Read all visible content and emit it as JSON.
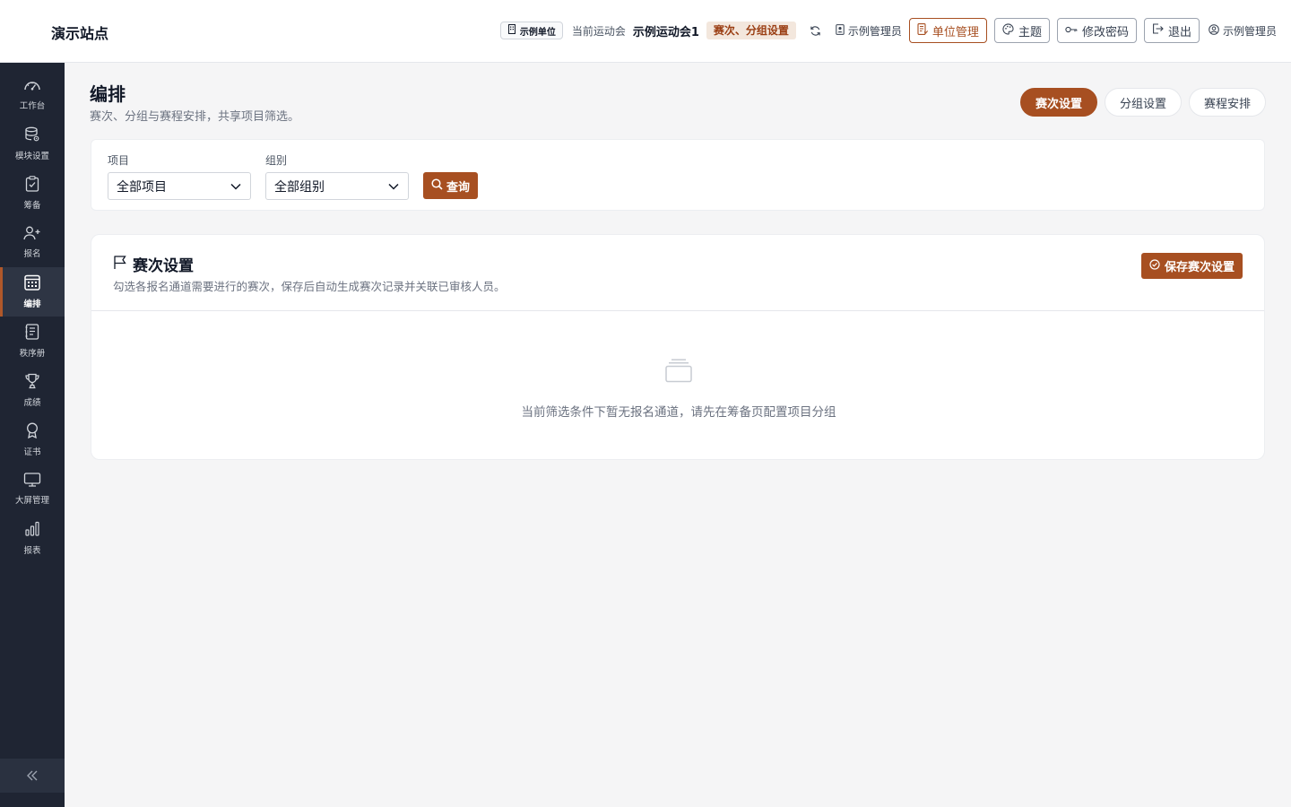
{
  "header": {
    "site_name": "演示站点",
    "unit_chip": "示例单位",
    "current_meet_label": "当前运动会",
    "current_meet": "示例运动会1",
    "setting_tag": "赛次、分组设置",
    "admin_role": "示例管理员",
    "buttons": {
      "unit_manage": "单位管理",
      "theme": "主题",
      "change_password": "修改密码",
      "logout": "退出"
    },
    "user_name": "示例管理员"
  },
  "sidebar": {
    "items": [
      {
        "label": "工作台",
        "icon": "dashboard-icon"
      },
      {
        "label": "模块设置",
        "icon": "database-icon"
      },
      {
        "label": "筹备",
        "icon": "clipboard-icon"
      },
      {
        "label": "报名",
        "icon": "user-add-icon"
      },
      {
        "label": "编排",
        "icon": "calendar-grid-icon",
        "active": true
      },
      {
        "label": "秩序册",
        "icon": "booklet-icon"
      },
      {
        "label": "成绩",
        "icon": "trophy-icon"
      },
      {
        "label": "证书",
        "icon": "award-icon"
      },
      {
        "label": "大屏管理",
        "icon": "monitor-icon"
      },
      {
        "label": "报表",
        "icon": "bar-chart-icon"
      }
    ],
    "collapse_icon": "double-chevron-left-icon"
  },
  "page": {
    "title": "编排",
    "subtitle": "赛次、分组与赛程安排，共享项目筛选。",
    "tabs": [
      {
        "label": "赛次设置",
        "active": true
      },
      {
        "label": "分组设置",
        "active": false
      },
      {
        "label": "赛程安排",
        "active": false
      }
    ]
  },
  "filters": {
    "project_label": "项目",
    "project_value": "全部项目",
    "group_label": "组别",
    "group_value": "全部组别",
    "query_button": "查询"
  },
  "round_card": {
    "title": "赛次设置",
    "description": "勾选各报名通道需要进行的赛次，保存后自动生成赛次记录并关联已审核人员。",
    "save_button": "保存赛次设置",
    "empty_text": "当前筛选条件下暂无报名通道，请先在筹备页配置项目分组"
  },
  "colors": {
    "accent": "#a74f21",
    "sidebar_bg": "#1f2533",
    "page_bg": "#f5f5f6"
  }
}
